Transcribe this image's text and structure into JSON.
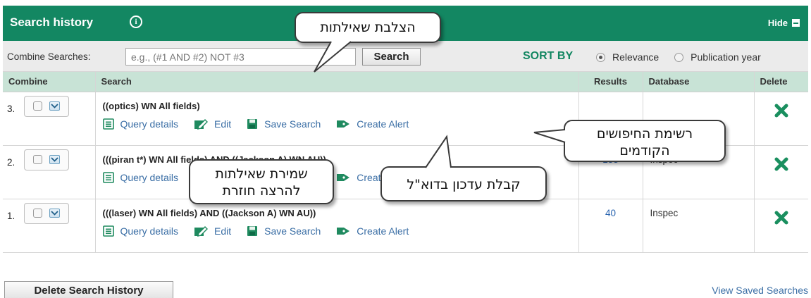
{
  "header": {
    "title": "Search history",
    "info_glyph": "i",
    "hide_label": "Hide"
  },
  "combine": {
    "label": "Combine Searches:",
    "placeholder": "e.g., (#1 AND #2) NOT #3",
    "search_button": "Search",
    "sort_label": "SORT BY",
    "sort_options": [
      {
        "label": "Relevance",
        "selected": true
      },
      {
        "label": "Publication year",
        "selected": false
      }
    ]
  },
  "columns": {
    "combine": "Combine",
    "search": "Search",
    "results": "Results",
    "database": "Database",
    "delete": "Delete"
  },
  "rows": [
    {
      "number": "3.",
      "query": "((optics) WN All fields)",
      "results": "",
      "database": ""
    },
    {
      "number": "2.",
      "query": "(((piran t*) WN All fields) AND ((Jackson A) WN AU))",
      "results": "133",
      "database": "Inspec"
    },
    {
      "number": "1.",
      "query": "(((laser) WN All fields) AND ((Jackson A) WN AU))",
      "results": "40",
      "database": "Inspec"
    }
  ],
  "actions": {
    "query_details": "Query details",
    "edit": "Edit",
    "save_search": "Save Search",
    "create_alert": "Create Alert"
  },
  "footer": {
    "delete_history": "Delete Search History",
    "view_saved": "View Saved Searches"
  },
  "callouts": {
    "combine_queries": "הצלבת שאילתות",
    "previous_searches": [
      "רשימת החיפושים",
      "הקודמים"
    ],
    "save_query": [
      "שמירת שאילתות",
      "להרצה חוזרת"
    ],
    "email_alert": "קבלת עדכון בדוא\"ל"
  },
  "colors": {
    "header_green": "#138762",
    "column_header": "#c8e3d6",
    "link_blue": "#3a6ea5",
    "delete_green": "#1a8f5f"
  },
  "icons": [
    "info-icon",
    "hide-icon",
    "checkbox",
    "dropdown-icon",
    "query-details-icon",
    "edit-icon",
    "save-icon",
    "alert-tag-icon",
    "delete-x-icon"
  ]
}
